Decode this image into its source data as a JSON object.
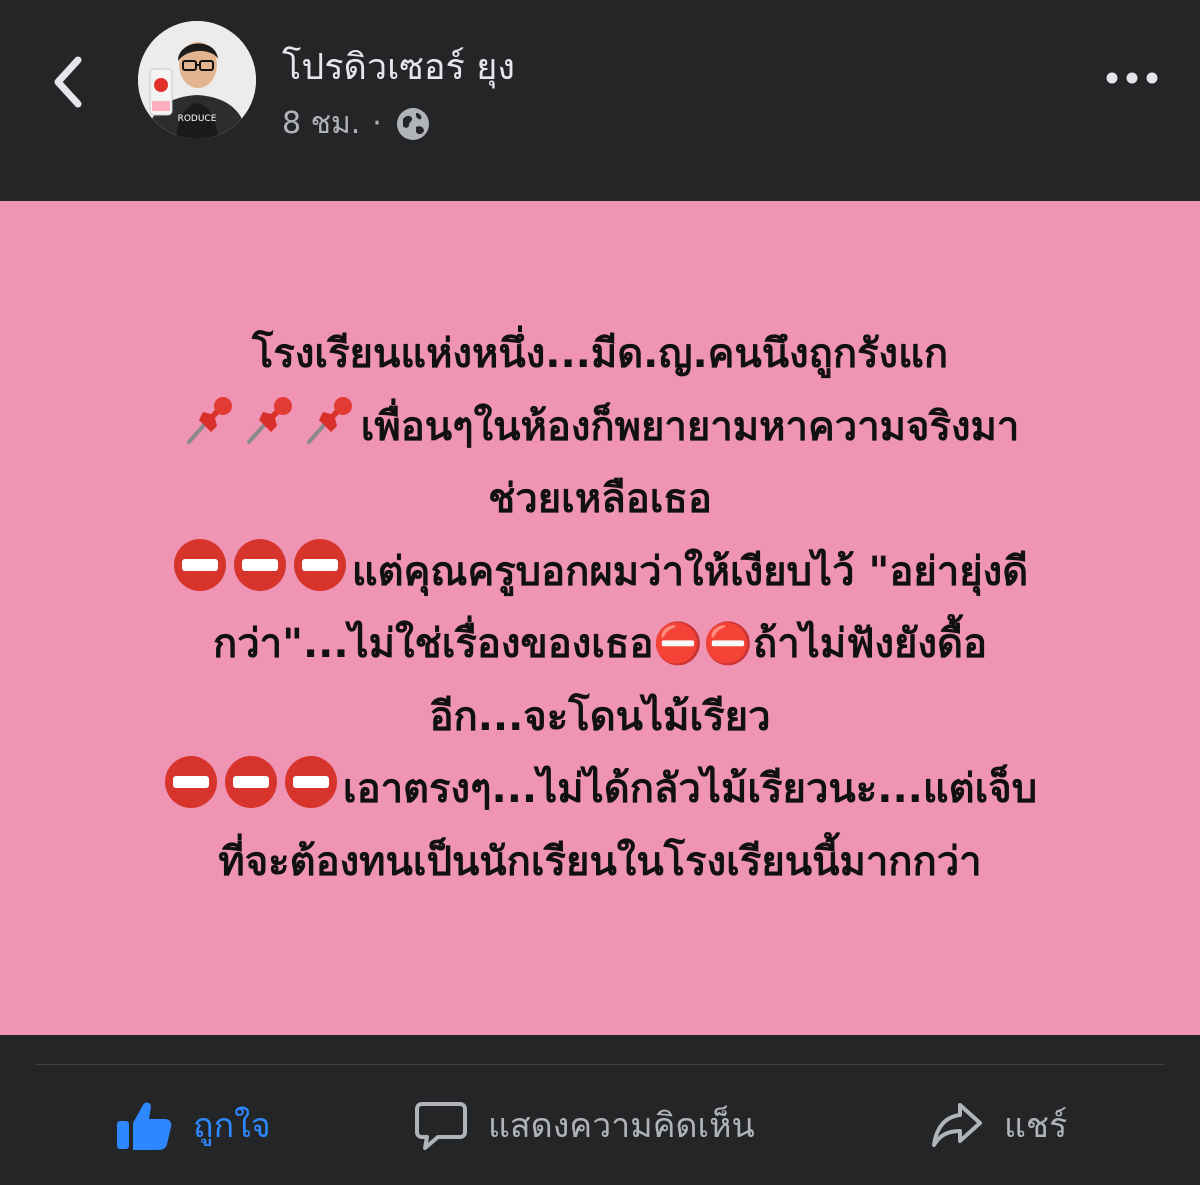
{
  "post": {
    "author_name": "โปรดิวเซอร์ ยุง",
    "timestamp": "8 ชม.",
    "separator": "·",
    "privacy_icon": "globe-icon",
    "body_lines": [
      {
        "emoji": [],
        "text": "โรงเรียนแห่งหนึ่ง...มีด.ญ.คนนึงถูกรังแก"
      },
      {
        "emoji": [
          "pushpin",
          "pushpin",
          "pushpin"
        ],
        "text": "เพื่อนๆในห้องก็พยายามหาความจริงมา"
      },
      {
        "emoji": [],
        "text": "ช่วยเหลือเธอ"
      },
      {
        "emoji": [
          "no-entry",
          "no-entry",
          "no-entry"
        ],
        "text": "แต่คุณครูบอกผมว่าให้เงียบไว้ \"อย่ายุ่งดี"
      },
      {
        "emoji": [],
        "text": "กว่า\"...ไม่ใช่เรื่องของเธอ⛔⛔ถ้าไม่ฟังยังดื้อ"
      },
      {
        "emoji": [],
        "text": "อีก...จะโดนไม้เรียว"
      },
      {
        "emoji": [
          "no-entry",
          "no-entry",
          "no-entry"
        ],
        "text": "เอาตรงๆ...ไม่ได้กลัวไม้เรียวนะ...แต่เจ็บ"
      },
      {
        "emoji": [],
        "text": "ที่จะต้องทนเป็นนักเรียนในโรงเรียนนี้มากกว่า"
      }
    ],
    "background_color": "#f094b4"
  },
  "actions": {
    "like_label": "ถูกใจ",
    "comment_label": "แสดงความคิดเห็น",
    "share_label": "แชร์"
  },
  "colors": {
    "app_bg": "#242526",
    "like_active": "#2d88ff",
    "secondary_text": "#b0b3b8"
  }
}
